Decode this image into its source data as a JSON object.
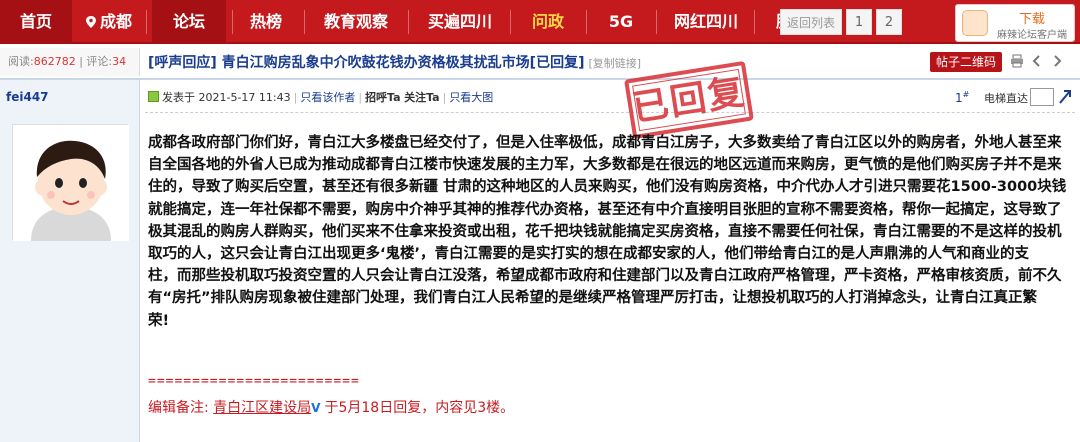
{
  "nav": {
    "items": [
      {
        "label": "首页"
      },
      {
        "label": "成都"
      },
      {
        "label": "论坛"
      },
      {
        "label": "热榜"
      },
      {
        "label": "教育观察"
      },
      {
        "label": "买遍四川"
      },
      {
        "label": "问政"
      },
      {
        "label": "5G"
      },
      {
        "label": "网红四川"
      },
      {
        "label": "服务"
      }
    ],
    "active_label": "论坛",
    "highlight_label": "问政",
    "pager": {
      "prev_label": "返回列表",
      "pages": [
        "1",
        "2"
      ]
    },
    "app_download": {
      "line1": "下载",
      "line2": "麻辣论坛客户端"
    }
  },
  "stats": {
    "views_label": "阅读:",
    "views": "862782",
    "comments_label": "评论:",
    "comments": "34"
  },
  "thread": {
    "title": "[呼声回应] 青白江购房乱象中介吹鼓花钱办资格极其扰乱市场[已回复]",
    "copy_link": "[复制链接]",
    "qr_button": "帖子二维码"
  },
  "post": {
    "author": "fei447",
    "posted_label": "发表于 2021-5-17 11:43",
    "only_author": "只看该作者",
    "greet": "招呼Ta",
    "follow": "关注Ta",
    "only_big_images": "只看大图",
    "floor": "1",
    "floor_suffix": "#",
    "jump_label": "电梯直达",
    "stamp": "已回复",
    "body_lines": [
      "成都各政府部门你们好，青白江大多楼盘已经交付了，但是入住率极低，成都青白江房子，大多数卖给了青白江区以外的购房者，外地人甚至来",
      "自全国各地的外省人已成为推动成都青白江楼市快速发展的主力军，大多数都是在很远的地区远道而来购房，更气愤的是他们购买房子并不是来",
      "住的，导致了购买后空置，甚至还有很多新疆 甘肃的这种地区的人员来购买，他们没有购房资格，中介代办人才引进只需要花1500-3000块钱",
      "就能搞定，连一年社保都不需要，购房中介神乎其神的推荐代办资格，甚至还有中介直接明目张胆的宣称不需要资格，帮你一起搞定，这导致了",
      "极其混乱的购房人群购买，他们买来不住拿来投资或出租，花千把块钱就能搞定买房资格，直接不需要任何社保，青白江需要的不是这样的投机",
      "取巧的人，这只会让青白江出现更多‘鬼楼’，青白江需要的是实打实的想在成都安家的人，他们带给青白江的是人声鼎沸的人气和商业的支",
      "柱，而那些投机取巧投资空置的人只会让青白江没落，希望成都市政府和住建部门以及青白江政府严格管理，严卡资格，严格审核资质，前不久",
      "有“房托”排队购房现象被住建部门处理，我们青白江人民希望的是继续严格管理严厉打击，让想投机取巧的人打消掉念头，让青白江真正繁",
      "荣!"
    ],
    "rule": "========================",
    "edit_prefix": "编辑备注:",
    "edit_dept": "青白江区建设局",
    "edit_dept_mark": "V",
    "edit_suffix": "于5月18日回复，内容见3楼。"
  },
  "colors": {
    "brand_red": "#c41a1e",
    "link_blue": "#1a3c8f",
    "stamp_red": "#d8343a"
  }
}
